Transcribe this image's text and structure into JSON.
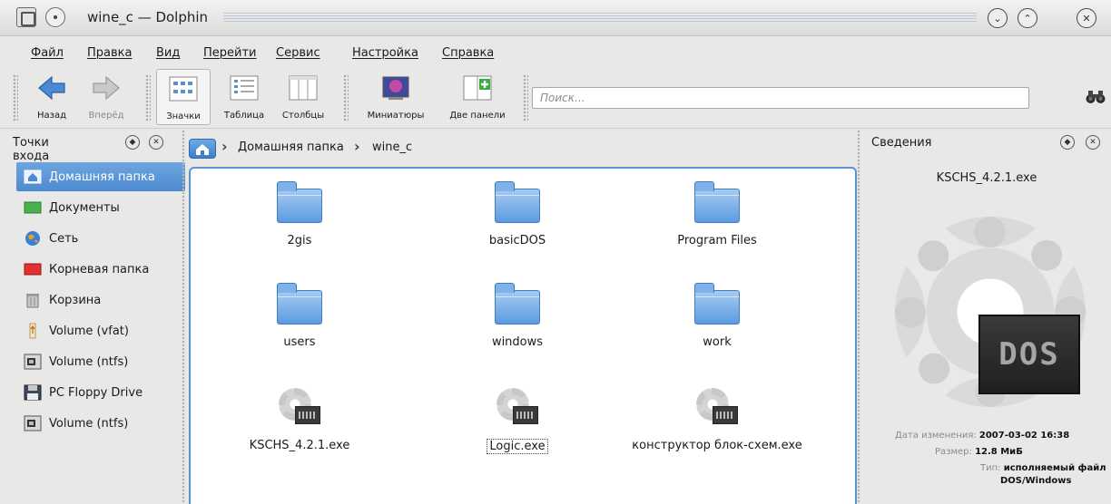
{
  "window": {
    "title": "wine_c — Dolphin"
  },
  "menu": [
    "Файл",
    "Правка",
    "Вид",
    "Перейти",
    "Сервис",
    "Настройка",
    "Справка"
  ],
  "toolbar": {
    "back": "Назад",
    "forward": "Вперёд",
    "icons": "Значки",
    "details": "Таблица",
    "columns": "Столбцы",
    "preview": "Миниатюры",
    "split": "Две панели",
    "search_placeholder": "Поиск..."
  },
  "places": {
    "title": "Точки входа",
    "items": [
      {
        "label": "Домашняя папка",
        "icon": "home-icon",
        "selected": true
      },
      {
        "label": "Документы",
        "icon": "documents-icon"
      },
      {
        "label": "Сеть",
        "icon": "network-globe-icon"
      },
      {
        "label": "Корневая папка",
        "icon": "root-folder-icon"
      },
      {
        "label": "Корзина",
        "icon": "trash-icon"
      },
      {
        "label": "Volume (vfat)",
        "icon": "usb-drive-icon"
      },
      {
        "label": "Volume (ntfs)",
        "icon": "hard-drive-icon"
      },
      {
        "label": "PC Floppy Drive",
        "icon": "floppy-icon"
      },
      {
        "label": "Volume (ntfs)",
        "icon": "hard-drive-icon"
      }
    ]
  },
  "breadcrumb": {
    "home": "Домашняя папка",
    "current": "wine_c"
  },
  "files": [
    {
      "name": "2gis",
      "type": "folder"
    },
    {
      "name": "basicDOS",
      "type": "folder"
    },
    {
      "name": "Program Files",
      "type": "folder"
    },
    {
      "name": "users",
      "type": "folder"
    },
    {
      "name": "windows",
      "type": "folder"
    },
    {
      "name": "work",
      "type": "folder"
    },
    {
      "name": "KSCHS_4.2.1.exe",
      "type": "exe"
    },
    {
      "name": "Logic.exe",
      "type": "exe",
      "focused": true
    },
    {
      "name": "конструктор блок-схем.exe",
      "type": "exe"
    }
  ],
  "info": {
    "title": "Сведения",
    "filename": "KSCHS_4.2.1.exe",
    "preview_text": "DOS",
    "modified_label": "Дата изменения:",
    "modified_value": "2007-03-02 16:38",
    "size_label": "Размер:",
    "size_value": "12.8 МиБ",
    "type_label": "Тип:",
    "type_value_1": "исполняемый файл",
    "type_value_2": "DOS/Windows"
  },
  "colors": {
    "selection": "#5b94d6",
    "folder": "#6aa3e3"
  }
}
